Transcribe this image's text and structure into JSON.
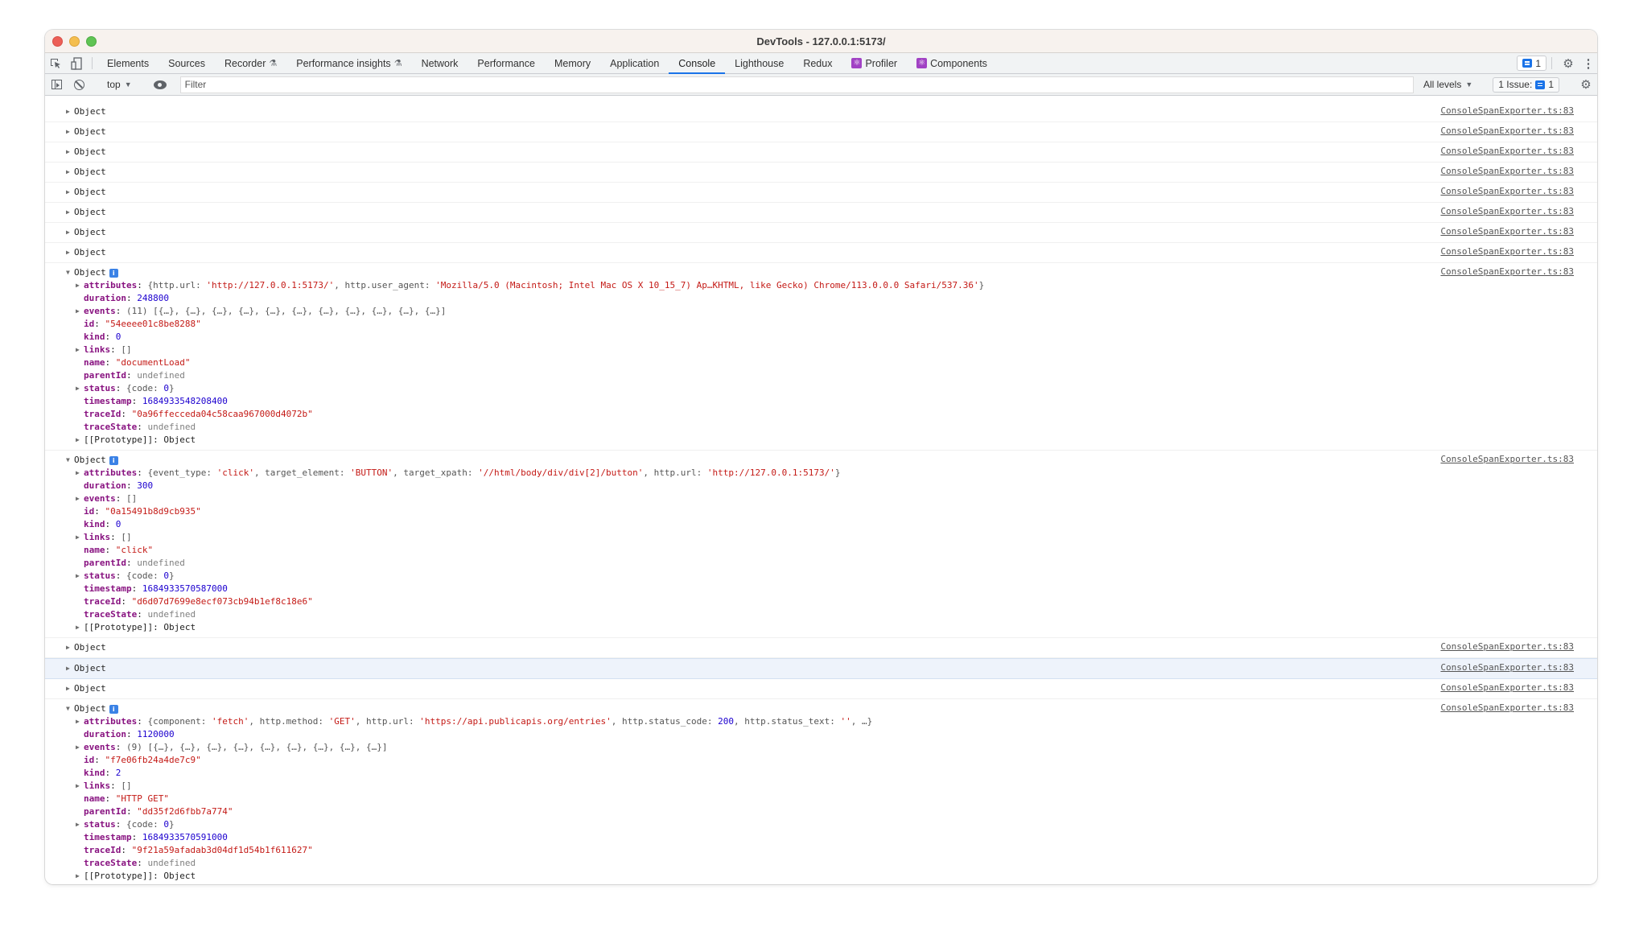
{
  "window": {
    "title": "DevTools - 127.0.0.1:5173/"
  },
  "tabbar": {
    "tabs": [
      {
        "label": "Elements",
        "badge": ""
      },
      {
        "label": "Sources",
        "badge": ""
      },
      {
        "label": "Recorder",
        "badge": "flask"
      },
      {
        "label": "Performance insights",
        "badge": "flask"
      },
      {
        "label": "Network",
        "badge": ""
      },
      {
        "label": "Performance",
        "badge": ""
      },
      {
        "label": "Memory",
        "badge": ""
      },
      {
        "label": "Application",
        "badge": ""
      },
      {
        "label": "Console",
        "badge": "",
        "active": true
      },
      {
        "label": "Lighthouse",
        "badge": ""
      },
      {
        "label": "Redux",
        "badge": ""
      },
      {
        "label": "Profiler",
        "badge": "react"
      },
      {
        "label": "Components",
        "badge": "react"
      }
    ],
    "message_count": "1"
  },
  "toolbar": {
    "context": "top",
    "filter_placeholder": "Filter",
    "filter_value": "",
    "levels": "All levels",
    "issues_label": "1 Issue:",
    "issues_count": "1"
  },
  "console": {
    "source": "ConsoleSpanExporter.ts:83",
    "collapsed_label": "Object",
    "entries": [
      {
        "expanded": false
      },
      {
        "expanded": false
      },
      {
        "expanded": false
      },
      {
        "expanded": false
      },
      {
        "expanded": false
      },
      {
        "expanded": false
      },
      {
        "expanded": false
      },
      {
        "expanded": false
      },
      {
        "expanded": true,
        "props": [
          {
            "key": "attributes",
            "expandable": true,
            "parts": [
              [
                "plain",
                "{http.url: "
              ],
              [
                "str",
                "'http://127.0.0.1:5173/'"
              ],
              [
                "plain",
                ", http.user_agent: "
              ],
              [
                "str",
                "'Mozilla/5.0 (Macintosh; Intel Mac OS X 10_15_7) Ap…KHTML, like Gecko) Chrome/113.0.0.0 Safari/537.36'"
              ],
              [
                "plain",
                "}"
              ]
            ]
          },
          {
            "key": "duration",
            "parts": [
              [
                "num",
                "248800"
              ]
            ]
          },
          {
            "key": "events",
            "expandable": true,
            "parts": [
              [
                "plain",
                "(11) [{…}, {…}, {…}, {…}, {…}, {…}, {…}, {…}, {…}, {…}, {…}]"
              ]
            ]
          },
          {
            "key": "id",
            "parts": [
              [
                "str",
                "\"54eeee01c8be8288\""
              ]
            ]
          },
          {
            "key": "kind",
            "parts": [
              [
                "num",
                "0"
              ]
            ]
          },
          {
            "key": "links",
            "expandable": true,
            "parts": [
              [
                "plain",
                "[]"
              ]
            ]
          },
          {
            "key": "name",
            "parts": [
              [
                "str",
                "\"documentLoad\""
              ]
            ]
          },
          {
            "key": "parentId",
            "parts": [
              [
                "undef",
                "undefined"
              ]
            ]
          },
          {
            "key": "status",
            "expandable": true,
            "parts": [
              [
                "plain",
                "{code: "
              ],
              [
                "num",
                "0"
              ],
              [
                "plain",
                "}"
              ]
            ]
          },
          {
            "key": "timestamp",
            "parts": [
              [
                "num",
                "1684933548208400"
              ]
            ]
          },
          {
            "key": "traceId",
            "parts": [
              [
                "str",
                "\"0a96ffecceda04c58caa967000d4072b\""
              ]
            ]
          },
          {
            "key": "traceState",
            "parts": [
              [
                "undef",
                "undefined"
              ]
            ]
          },
          {
            "key": "[[Prototype]]",
            "proto": true,
            "expandable": true,
            "parts": [
              [
                "plain2",
                "Object"
              ]
            ]
          }
        ]
      },
      {
        "expanded": true,
        "props": [
          {
            "key": "attributes",
            "expandable": true,
            "parts": [
              [
                "plain",
                "{event_type: "
              ],
              [
                "str",
                "'click'"
              ],
              [
                "plain",
                ", target_element: "
              ],
              [
                "str",
                "'BUTTON'"
              ],
              [
                "plain",
                ", target_xpath: "
              ],
              [
                "str",
                "'//html/body/div/div[2]/button'"
              ],
              [
                "plain",
                ", http.url: "
              ],
              [
                "str",
                "'http://127.0.0.1:5173/'"
              ],
              [
                "plain",
                "}"
              ]
            ]
          },
          {
            "key": "duration",
            "parts": [
              [
                "num",
                "300"
              ]
            ]
          },
          {
            "key": "events",
            "expandable": true,
            "parts": [
              [
                "plain",
                "[]"
              ]
            ]
          },
          {
            "key": "id",
            "parts": [
              [
                "str",
                "\"0a15491b8d9cb935\""
              ]
            ]
          },
          {
            "key": "kind",
            "parts": [
              [
                "num",
                "0"
              ]
            ]
          },
          {
            "key": "links",
            "expandable": true,
            "parts": [
              [
                "plain",
                "[]"
              ]
            ]
          },
          {
            "key": "name",
            "parts": [
              [
                "str",
                "\"click\""
              ]
            ]
          },
          {
            "key": "parentId",
            "parts": [
              [
                "undef",
                "undefined"
              ]
            ]
          },
          {
            "key": "status",
            "expandable": true,
            "parts": [
              [
                "plain",
                "{code: "
              ],
              [
                "num",
                "0"
              ],
              [
                "plain",
                "}"
              ]
            ]
          },
          {
            "key": "timestamp",
            "parts": [
              [
                "num",
                "1684933570587000"
              ]
            ]
          },
          {
            "key": "traceId",
            "parts": [
              [
                "str",
                "\"d6d07d7699e8ecf073cb94b1ef8c18e6\""
              ]
            ]
          },
          {
            "key": "traceState",
            "parts": [
              [
                "undef",
                "undefined"
              ]
            ]
          },
          {
            "key": "[[Prototype]]",
            "proto": true,
            "expandable": true,
            "parts": [
              [
                "plain2",
                "Object"
              ]
            ]
          }
        ]
      },
      {
        "expanded": false
      },
      {
        "expanded": false,
        "hover": true
      },
      {
        "expanded": false
      },
      {
        "expanded": true,
        "props": [
          {
            "key": "attributes",
            "expandable": true,
            "parts": [
              [
                "plain",
                "{component: "
              ],
              [
                "str",
                "'fetch'"
              ],
              [
                "plain",
                ", http.method: "
              ],
              [
                "str",
                "'GET'"
              ],
              [
                "plain",
                ", http.url: "
              ],
              [
                "str",
                "'https://api.publicapis.org/entries'"
              ],
              [
                "plain",
                ", http.status_code: "
              ],
              [
                "num",
                "200"
              ],
              [
                "plain",
                ", http.status_text: "
              ],
              [
                "str",
                "''"
              ],
              [
                "plain",
                ", …}"
              ]
            ]
          },
          {
            "key": "duration",
            "parts": [
              [
                "num",
                "1120000"
              ]
            ]
          },
          {
            "key": "events",
            "expandable": true,
            "parts": [
              [
                "plain",
                "(9) [{…}, {…}, {…}, {…}, {…}, {…}, {…}, {…}, {…}]"
              ]
            ]
          },
          {
            "key": "id",
            "parts": [
              [
                "str",
                "\"f7e06fb24a4de7c9\""
              ]
            ]
          },
          {
            "key": "kind",
            "parts": [
              [
                "num",
                "2"
              ]
            ]
          },
          {
            "key": "links",
            "expandable": true,
            "parts": [
              [
                "plain",
                "[]"
              ]
            ]
          },
          {
            "key": "name",
            "parts": [
              [
                "str",
                "\"HTTP GET\""
              ]
            ]
          },
          {
            "key": "parentId",
            "parts": [
              [
                "str",
                "\"dd35f2d6fbb7a774\""
              ]
            ]
          },
          {
            "key": "status",
            "expandable": true,
            "parts": [
              [
                "plain",
                "{code: "
              ],
              [
                "num",
                "0"
              ],
              [
                "plain",
                "}"
              ]
            ]
          },
          {
            "key": "timestamp",
            "parts": [
              [
                "num",
                "1684933570591000"
              ]
            ]
          },
          {
            "key": "traceId",
            "parts": [
              [
                "str",
                "\"9f21a59afadab3d04df1d54b1f611627\""
              ]
            ]
          },
          {
            "key": "traceState",
            "parts": [
              [
                "undef",
                "undefined"
              ]
            ]
          },
          {
            "key": "[[Prototype]]",
            "proto": true,
            "expandable": true,
            "parts": [
              [
                "plain2",
                "Object"
              ]
            ]
          }
        ]
      }
    ],
    "prompt_symbol": "›"
  },
  "colors": {
    "accent": "#1a73e8",
    "string": "#c41a16",
    "number": "#1c00cf",
    "key": "#881280",
    "undefined": "#808080"
  }
}
